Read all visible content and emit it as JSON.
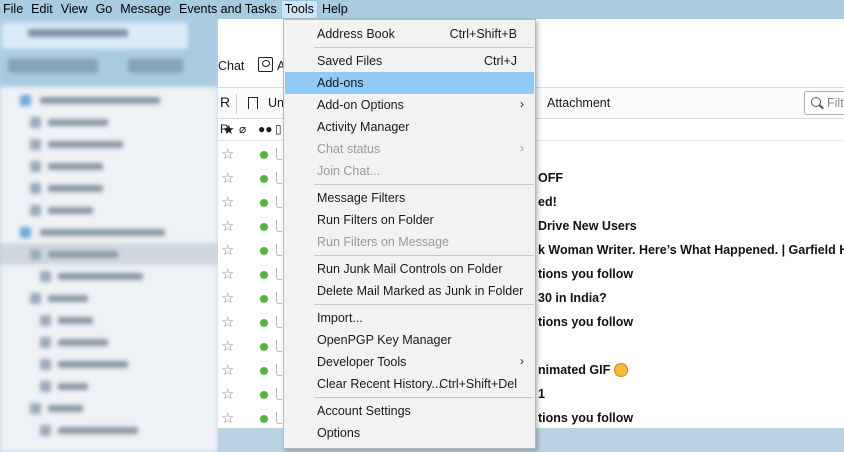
{
  "menubar": {
    "items": [
      "File",
      "Edit",
      "View",
      "Go",
      "Message",
      "Events and Tasks",
      "Tools",
      "Help"
    ]
  },
  "toolbar": {
    "chat": "Chat",
    "a_partial": "A",
    "unread_partial": "Un",
    "attachment": "Attachment",
    "filter_placeholder": "Filt"
  },
  "messages": {
    "subjects": [
      "",
      "OFF",
      "ed!",
      " Drive New Users",
      "k Woman Writer. Here’s What Happened. | Garfield Hylto",
      "tions you follow",
      "30 in India?",
      "tions you follow",
      "",
      "nimated GIF",
      "1",
      "tions you follow"
    ]
  },
  "tools_menu": {
    "address_book": "Address Book",
    "address_book_sc": "Ctrl+Shift+B",
    "saved_files": "Saved Files",
    "saved_files_sc": "Ctrl+J",
    "addons": "Add-ons",
    "addon_options": "Add-on Options",
    "activity_manager": "Activity Manager",
    "chat_status": "Chat status",
    "join_chat": "Join Chat...",
    "message_filters": "Message Filters",
    "run_filters_folder": "Run Filters on Folder",
    "run_filters_message": "Run Filters on Message",
    "run_junk": "Run Junk Mail Controls on Folder",
    "delete_junk": "Delete Mail Marked as Junk in Folder",
    "import": "Import...",
    "openpgp": "OpenPGP Key Manager",
    "developer_tools": "Developer Tools",
    "clear_history": "Clear Recent History...",
    "clear_history_sc": "Ctrl+Shift+Del",
    "account_settings": "Account Settings",
    "options": "Options"
  },
  "colors": {
    "menubar_bg": "#a9cbe0",
    "menu_highlight": "#91c9f7",
    "unread_dot": "#57b33e"
  }
}
